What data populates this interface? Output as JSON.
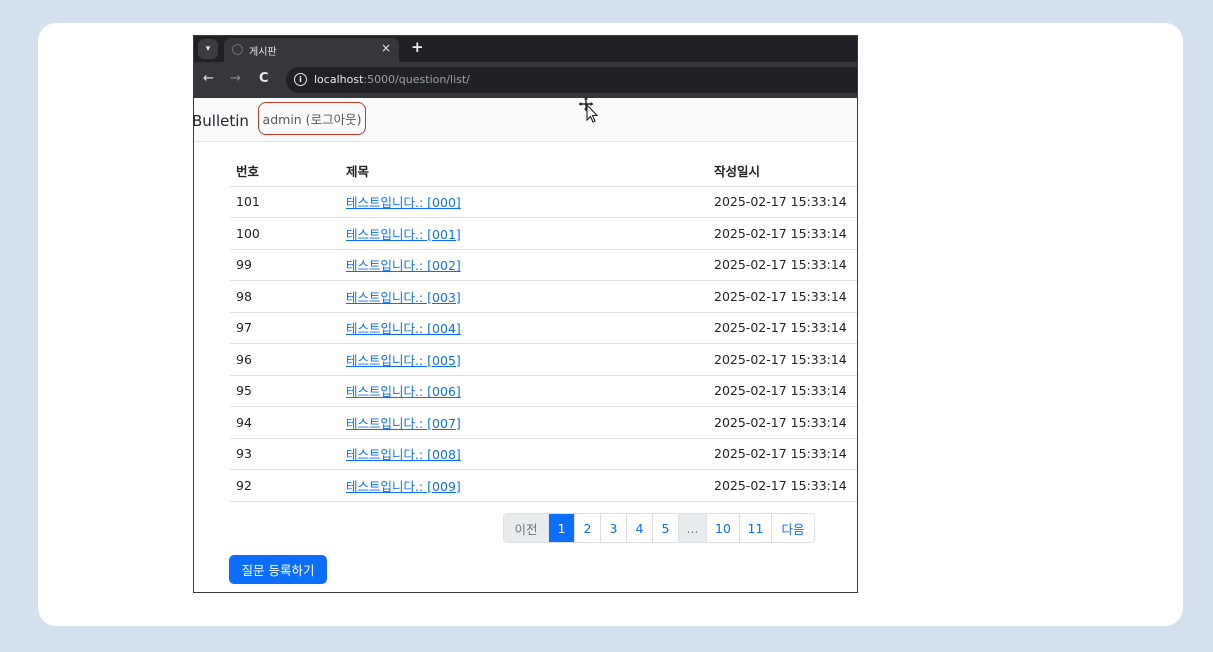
{
  "browser": {
    "tab_title": "게시판",
    "tab_close": "×",
    "new_tab": "+",
    "url_host": "localhost",
    "url_path": ":5000/question/list/"
  },
  "navbar": {
    "brand": "Bulletin",
    "logout_label": "admin (로그아웃)"
  },
  "table": {
    "headers": [
      "번호",
      "제목",
      "작성일시"
    ],
    "rows": [
      {
        "num": "101",
        "title": "테스트입니다.: [000]",
        "date": "2025-02-17 15:33:14"
      },
      {
        "num": "100",
        "title": "테스트입니다.: [001]",
        "date": "2025-02-17 15:33:14"
      },
      {
        "num": "99",
        "title": "테스트입니다.: [002]",
        "date": "2025-02-17 15:33:14"
      },
      {
        "num": "98",
        "title": "테스트입니다.: [003]",
        "date": "2025-02-17 15:33:14"
      },
      {
        "num": "97",
        "title": "테스트입니다.: [004]",
        "date": "2025-02-17 15:33:14"
      },
      {
        "num": "96",
        "title": "테스트입니다.: [005]",
        "date": "2025-02-17 15:33:14"
      },
      {
        "num": "95",
        "title": "테스트입니다.: [006]",
        "date": "2025-02-17 15:33:14"
      },
      {
        "num": "94",
        "title": "테스트입니다.: [007]",
        "date": "2025-02-17 15:33:14"
      },
      {
        "num": "93",
        "title": "테스트입니다.: [008]",
        "date": "2025-02-17 15:33:14"
      },
      {
        "num": "92",
        "title": "테스트입니다.: [009]",
        "date": "2025-02-17 15:33:14"
      }
    ]
  },
  "pagination": {
    "prev": "이전",
    "pages": [
      "1",
      "2",
      "3",
      "4",
      "5"
    ],
    "ellipsis": "...",
    "last_pages": [
      "10",
      "11"
    ],
    "next": "다음",
    "active_page": "1"
  },
  "register_button": "질문 등록하기",
  "colors": {
    "primary": "#0d6efd",
    "logout_border": "#c0392b",
    "page_background": "#d3e1ef"
  }
}
